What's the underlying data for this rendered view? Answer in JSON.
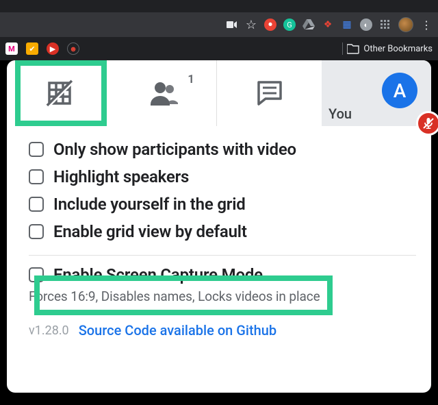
{
  "browser": {
    "other_bookmarks_label": "Other Bookmarks"
  },
  "tabs": {
    "you_label": "You",
    "avatar_initial": "A",
    "people_badge": "1"
  },
  "options": [
    {
      "label": "Only show participants with video"
    },
    {
      "label": "Highlight speakers"
    },
    {
      "label": "Include yourself in the grid"
    },
    {
      "label": "Enable grid view by default"
    }
  ],
  "capture": {
    "label": "Enable Screen Capture Mode",
    "desc": "Forces 16:9, Disables names, Locks videos in place"
  },
  "footer": {
    "version": "v1.28.0",
    "link": "Source Code available on Github"
  }
}
